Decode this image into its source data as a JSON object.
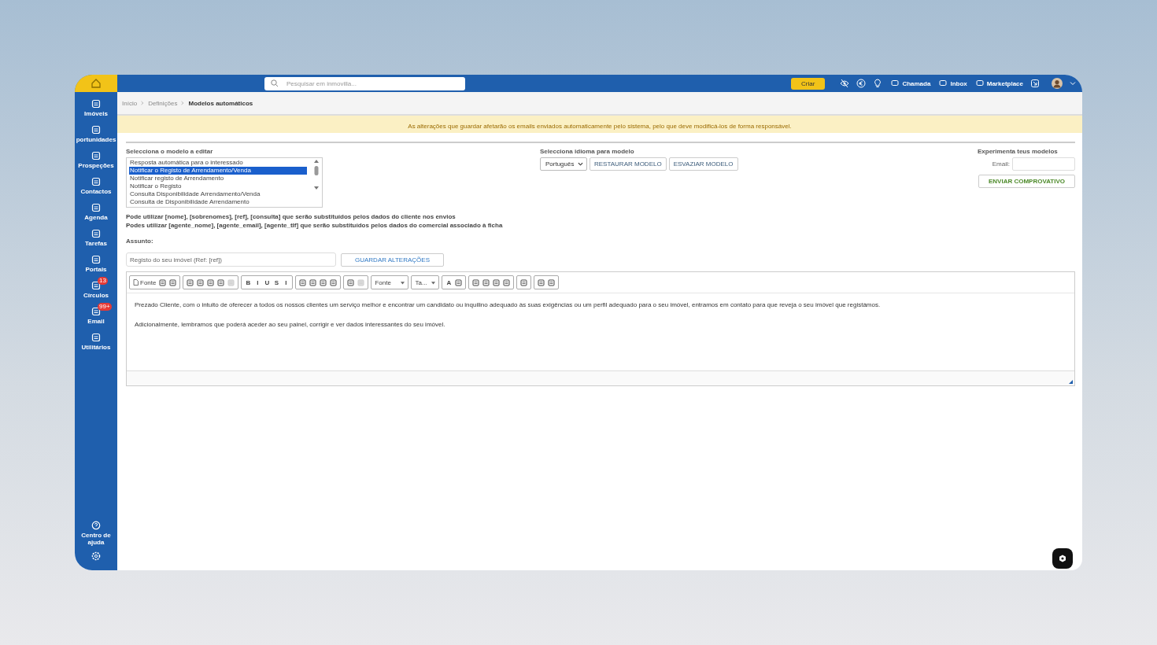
{
  "topbar": {
    "search": {
      "placeholder": "Pesquisar em inmovilla..."
    },
    "create_button": "Criar",
    "actions": [
      {
        "label": "Chamada"
      },
      {
        "label": "Inbox"
      },
      {
        "label": "Marketplace"
      }
    ]
  },
  "sidebar": {
    "items": [
      {
        "label": "Imóveis"
      },
      {
        "label": "portunidades"
      },
      {
        "label": "Prospeções"
      },
      {
        "label": "Contactos"
      },
      {
        "label": "Agenda"
      },
      {
        "label": "Tarefas"
      },
      {
        "label": "Portais"
      },
      {
        "label": "Círculos",
        "badge": "13"
      },
      {
        "label": "Email",
        "badge": "99+"
      },
      {
        "label": "Utilitários"
      }
    ],
    "bottom_items": [
      {
        "label": "Centro de ajuda"
      }
    ]
  },
  "breadcrumb": [
    {
      "label": "Início",
      "current": false
    },
    {
      "label": "Definições",
      "current": false
    },
    {
      "label": "Modelos automáticos",
      "current": true
    }
  ],
  "notice": "As alterações que guardar afetarão os emails enviados automaticamente pelo sistema, pelo que deve modificá-los de forma responsável.",
  "model_select": {
    "label": "Selecciona o modelo a editar",
    "options": [
      {
        "label": "Resposta automática para o interessado",
        "selected": false
      },
      {
        "label": "Notificar o Registo de Arrendamento/Venda",
        "selected": true
      },
      {
        "label": "Notificar registo de Arrendamento",
        "selected": false
      },
      {
        "label": "Notificar o Registo",
        "selected": false
      },
      {
        "label": "Consulta Disponibilidade Arrendamento/Venda",
        "selected": false
      },
      {
        "label": "Consulta de Disponibilidade Arrendamento",
        "selected": false
      }
    ]
  },
  "language": {
    "label": "Selecciona idioma para modelo",
    "value": "Português",
    "buttons": [
      "RESTAURAR MODELO",
      "ESVAZIAR MODELO"
    ]
  },
  "test": {
    "title": "Experimenta teus modelos",
    "email_label": "Email:",
    "button": "ENVIAR COMPROVATIVO"
  },
  "hints": [
    "Pode utilizar [nome], [sobrenomes], [ref], [consulta] que serão substituídos pelos dados do cliente nos envios",
    "Podes utilizar [agente_nome], [agente_email], [agente_tlf] que serão substituídos pelos dados do comercial associado à ficha"
  ],
  "subject": {
    "label": "Assunto:",
    "value": "Registo do seu imóvel (Ref: [ref])",
    "save_button": "GUARDAR ALTERAÇÕES"
  },
  "editor": {
    "toolbar": [
      [
        {
          "kind": "labeled",
          "label": "Fonte"
        },
        {
          "kind": "icon",
          "disabled": false
        },
        {
          "kind": "icon",
          "disabled": false
        }
      ],
      [
        {
          "kind": "icon",
          "disabled": false
        },
        {
          "kind": "icon",
          "disabled": false
        },
        {
          "kind": "icon",
          "disabled": false
        },
        {
          "kind": "icon",
          "disabled": false
        },
        {
          "kind": "icon",
          "disabled": true
        }
      ],
      [
        {
          "kind": "letter",
          "label": "B"
        },
        {
          "kind": "letter",
          "label": "I"
        },
        {
          "kind": "letter",
          "label": "U"
        },
        {
          "kind": "letter",
          "label": "S"
        },
        {
          "kind": "letter",
          "label": "I"
        }
      ],
      [
        {
          "kind": "icon",
          "disabled": false
        },
        {
          "kind": "icon",
          "disabled": false
        },
        {
          "kind": "icon",
          "disabled": false
        },
        {
          "kind": "icon",
          "disabled": false
        }
      ],
      [
        {
          "kind": "icon",
          "disabled": false
        },
        {
          "kind": "icon",
          "disabled": true
        }
      ],
      [
        {
          "kind": "dropdown",
          "label": "Fonte"
        }
      ],
      [
        {
          "kind": "dropdown",
          "label": "Ta..."
        }
      ],
      [
        {
          "kind": "letter",
          "label": "A"
        },
        {
          "kind": "icon",
          "disabled": false
        }
      ],
      [
        {
          "kind": "icon",
          "disabled": false
        },
        {
          "kind": "icon",
          "disabled": false
        },
        {
          "kind": "icon",
          "disabled": false
        },
        {
          "kind": "icon",
          "disabled": false
        }
      ],
      [
        {
          "kind": "icon",
          "disabled": false
        }
      ],
      [
        {
          "kind": "icon",
          "disabled": false
        },
        {
          "kind": "icon",
          "disabled": false
        }
      ]
    ],
    "paragraphs": [
      "Prezado Cliente, com o intuito de oferecer a todos os nossos clientes um serviço melhor e encontrar um candidato ou inquilino adequado às suas exigências ou um perfil adequado para o seu imóvel, entramos em contato para que reveja o seu imóvel que registámos.",
      "Adicionalmente, lembramos que poderá aceder ao seu painel, corrigir e ver dados interessantes do seu imóvel."
    ]
  }
}
